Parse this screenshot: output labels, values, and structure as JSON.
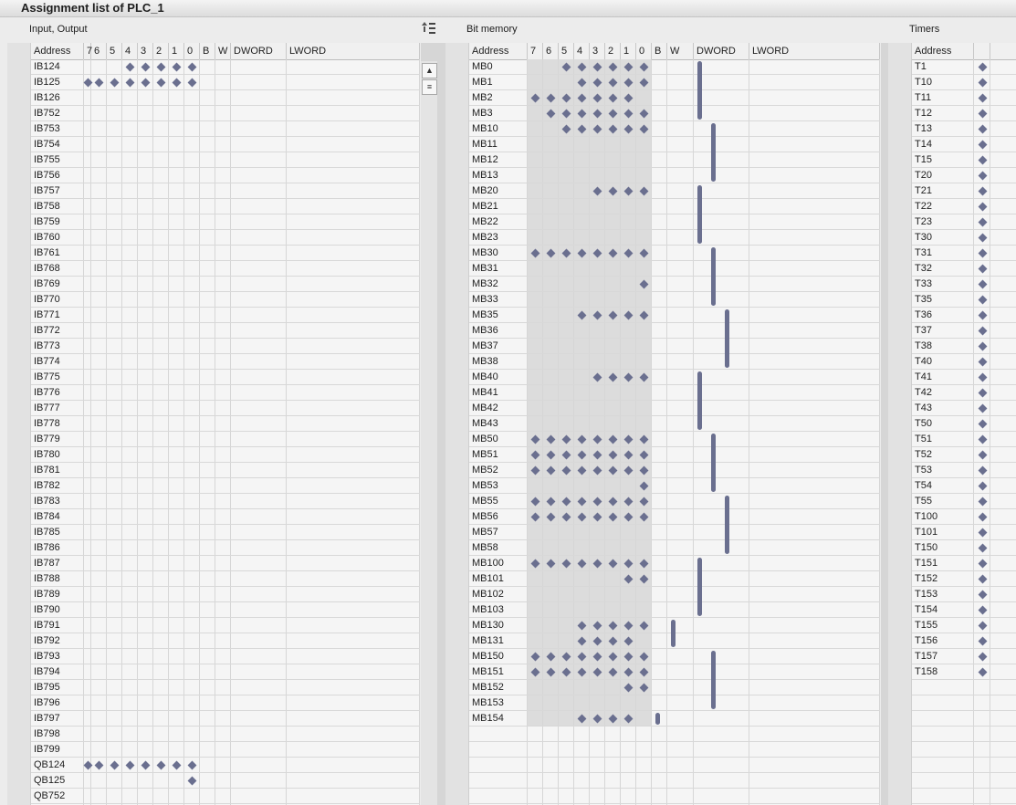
{
  "title": "Assignment list of PLC_1",
  "io": {
    "label": "Input, Output",
    "headers": [
      "Address",
      "7",
      "6",
      "5",
      "4",
      "3",
      "2",
      "1",
      "0",
      "B",
      "W",
      "DWORD",
      "LWORD"
    ],
    "rows": [
      {
        "a": "IB124",
        "bits": [
          4,
          3,
          2,
          1,
          0
        ]
      },
      {
        "a": "IB125",
        "bits": [
          7,
          6,
          5,
          4,
          3,
          2,
          1,
          0
        ]
      },
      {
        "a": "IB126"
      },
      {
        "a": "IB752"
      },
      {
        "a": "IB753"
      },
      {
        "a": "IB754"
      },
      {
        "a": "IB755"
      },
      {
        "a": "IB756"
      },
      {
        "a": "IB757"
      },
      {
        "a": "IB758"
      },
      {
        "a": "IB759"
      },
      {
        "a": "IB760"
      },
      {
        "a": "IB761"
      },
      {
        "a": "IB768"
      },
      {
        "a": "IB769"
      },
      {
        "a": "IB770"
      },
      {
        "a": "IB771"
      },
      {
        "a": "IB772"
      },
      {
        "a": "IB773"
      },
      {
        "a": "IB774"
      },
      {
        "a": "IB775"
      },
      {
        "a": "IB776"
      },
      {
        "a": "IB777"
      },
      {
        "a": "IB778"
      },
      {
        "a": "IB779"
      },
      {
        "a": "IB780"
      },
      {
        "a": "IB781"
      },
      {
        "a": "IB782"
      },
      {
        "a": "IB783"
      },
      {
        "a": "IB784"
      },
      {
        "a": "IB785"
      },
      {
        "a": "IB786"
      },
      {
        "a": "IB787"
      },
      {
        "a": "IB788"
      },
      {
        "a": "IB789"
      },
      {
        "a": "IB790"
      },
      {
        "a": "IB791"
      },
      {
        "a": "IB792"
      },
      {
        "a": "IB793"
      },
      {
        "a": "IB794"
      },
      {
        "a": "IB795"
      },
      {
        "a": "IB796"
      },
      {
        "a": "IB797"
      },
      {
        "a": "IB798"
      },
      {
        "a": "IB799"
      },
      {
        "a": "QB124",
        "bits": [
          7,
          6,
          5,
          4,
          3,
          2,
          1,
          0
        ]
      },
      {
        "a": "QB125",
        "bits": [
          0
        ]
      },
      {
        "a": "QB752"
      }
    ]
  },
  "mem": {
    "label": "Bit memory",
    "headers": [
      "Address",
      "7",
      "6",
      "5",
      "4",
      "3",
      "2",
      "1",
      "0",
      "B",
      "W",
      "DWORD",
      "LWORD"
    ],
    "rows": [
      {
        "a": "MB0",
        "bits": [
          5,
          4,
          3,
          2,
          1,
          0
        ]
      },
      {
        "a": "MB1",
        "bits": [
          4,
          3,
          2,
          1,
          0
        ]
      },
      {
        "a": "MB2",
        "bits": [
          7,
          6,
          5,
          4,
          3,
          2,
          1
        ]
      },
      {
        "a": "MB3",
        "bits": [
          6,
          5,
          4,
          3,
          2,
          1,
          0
        ]
      },
      {
        "a": "MB10",
        "bits": [
          5,
          4,
          3,
          2,
          1,
          0
        ]
      },
      {
        "a": "MB11"
      },
      {
        "a": "MB12"
      },
      {
        "a": "MB13"
      },
      {
        "a": "MB20",
        "bits": [
          3,
          2,
          1,
          0
        ]
      },
      {
        "a": "MB21"
      },
      {
        "a": "MB22"
      },
      {
        "a": "MB23"
      },
      {
        "a": "MB30",
        "bits": [
          7,
          6,
          5,
          4,
          3,
          2,
          1,
          0
        ]
      },
      {
        "a": "MB31"
      },
      {
        "a": "MB32",
        "bits": [
          0
        ]
      },
      {
        "a": "MB33"
      },
      {
        "a": "MB35",
        "bits": [
          4,
          3,
          2,
          1,
          0
        ]
      },
      {
        "a": "MB36"
      },
      {
        "a": "MB37"
      },
      {
        "a": "MB38"
      },
      {
        "a": "MB40",
        "bits": [
          3,
          2,
          1,
          0
        ]
      },
      {
        "a": "MB41"
      },
      {
        "a": "MB42"
      },
      {
        "a": "MB43"
      },
      {
        "a": "MB50",
        "bits": [
          7,
          6,
          5,
          4,
          3,
          2,
          1,
          0
        ]
      },
      {
        "a": "MB51",
        "bits": [
          7,
          6,
          5,
          4,
          3,
          2,
          1,
          0
        ]
      },
      {
        "a": "MB52",
        "bits": [
          7,
          6,
          5,
          4,
          3,
          2,
          1,
          0
        ]
      },
      {
        "a": "MB53",
        "bits": [
          0
        ]
      },
      {
        "a": "MB55",
        "bits": [
          7,
          6,
          5,
          4,
          3,
          2,
          1,
          0
        ]
      },
      {
        "a": "MB56",
        "bits": [
          7,
          6,
          5,
          4,
          3,
          2,
          1,
          0
        ]
      },
      {
        "a": "MB57"
      },
      {
        "a": "MB58"
      },
      {
        "a": "MB100",
        "bits": [
          7,
          6,
          5,
          4,
          3,
          2,
          1,
          0
        ]
      },
      {
        "a": "MB101",
        "bits": [
          1,
          0
        ]
      },
      {
        "a": "MB102"
      },
      {
        "a": "MB103"
      },
      {
        "a": "MB130",
        "bits": [
          4,
          3,
          2,
          1,
          0
        ]
      },
      {
        "a": "MB131",
        "bits": [
          4,
          3,
          2,
          1
        ]
      },
      {
        "a": "MB150",
        "bits": [
          7,
          6,
          5,
          4,
          3,
          2,
          1,
          0
        ]
      },
      {
        "a": "MB151",
        "bits": [
          7,
          6,
          5,
          4,
          3,
          2,
          1,
          0
        ]
      },
      {
        "a": "MB152",
        "bits": [
          1,
          0
        ]
      },
      {
        "a": "MB153"
      },
      {
        "a": "MB154",
        "bits": [
          4,
          3,
          2,
          1
        ]
      }
    ],
    "spans": [
      {
        "col": "DWORD",
        "start": 0,
        "len": 4,
        "offset": 0
      },
      {
        "col": "DWORD",
        "start": 4,
        "len": 4,
        "offset": 1
      },
      {
        "col": "DWORD",
        "start": 8,
        "len": 4,
        "offset": 0
      },
      {
        "col": "DWORD",
        "start": 12,
        "len": 4,
        "offset": 1
      },
      {
        "col": "DWORD",
        "start": 16,
        "len": 4,
        "offset": 2
      },
      {
        "col": "DWORD",
        "start": 20,
        "len": 4,
        "offset": 0
      },
      {
        "col": "DWORD",
        "start": 24,
        "len": 4,
        "offset": 1
      },
      {
        "col": "DWORD",
        "start": 28,
        "len": 4,
        "offset": 2
      },
      {
        "col": "DWORD",
        "start": 32,
        "len": 4,
        "offset": 0
      },
      {
        "col": "W",
        "start": 36,
        "len": 2,
        "offset": 0
      },
      {
        "col": "DWORD",
        "start": 38,
        "len": 4,
        "offset": 1
      },
      {
        "col": "B",
        "start": 42,
        "len": 1,
        "offset": 0
      }
    ]
  },
  "timers": {
    "label": "Timers",
    "header": "Address",
    "rows": [
      "T1",
      "T10",
      "T11",
      "T12",
      "T13",
      "T14",
      "T15",
      "T20",
      "T21",
      "T22",
      "T23",
      "T30",
      "T31",
      "T32",
      "T33",
      "T35",
      "T36",
      "T37",
      "T38",
      "T40",
      "T41",
      "T42",
      "T43",
      "T50",
      "T51",
      "T52",
      "T53",
      "T54",
      "T55",
      "T100",
      "T101",
      "T150",
      "T151",
      "T152",
      "T153",
      "T154",
      "T155",
      "T156",
      "T157",
      "T158"
    ]
  },
  "colors": {
    "marker": "#6a6f8f",
    "shade": "#dcdcdc"
  },
  "icons": {
    "sort": "sort-icon",
    "scroll_up": "scroll-up-icon",
    "scroll_menu": "scroll-menu-icon"
  }
}
